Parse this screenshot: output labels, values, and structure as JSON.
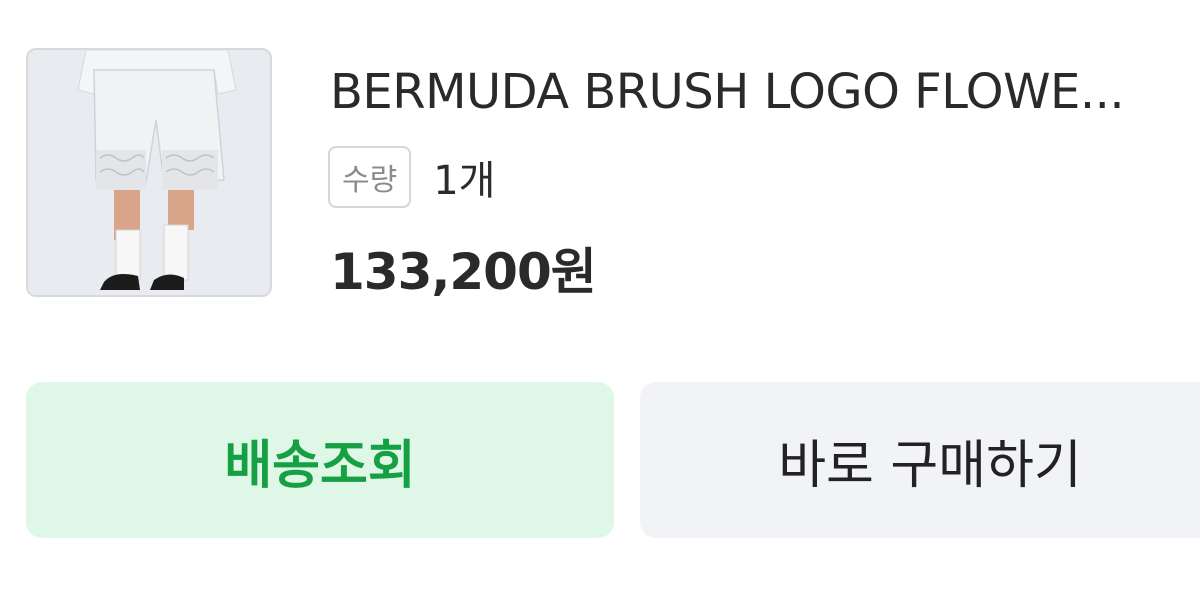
{
  "product": {
    "title": "BERMUDA BRUSH LOGO FLOWE...",
    "quantity_label": "수량",
    "quantity_value": "1개",
    "price": "133,200원",
    "image_alt": "product-thumbnail"
  },
  "actions": {
    "track_label": "배송조회",
    "buy_label": "바로 구매하기"
  },
  "colors": {
    "track_bg": "#dff7e6",
    "track_text": "#14a043",
    "buy_bg": "#f2f3f6"
  }
}
